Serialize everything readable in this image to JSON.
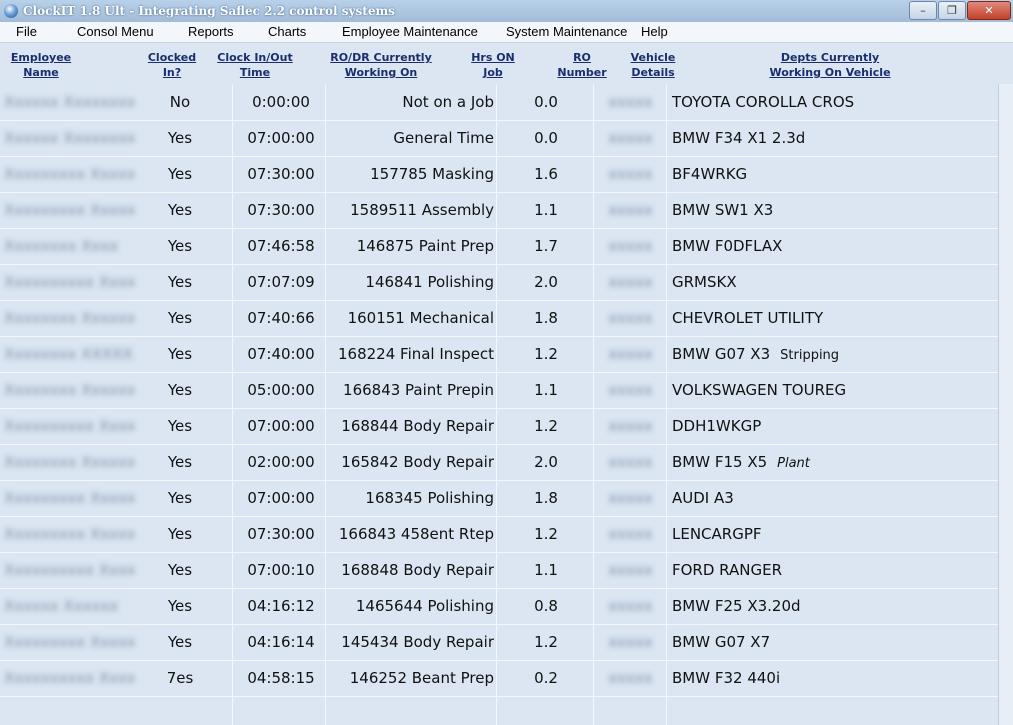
{
  "window": {
    "title": "ClockIT 1.8 Ult - Integrating Saflec 2.2 control systems",
    "minimize_glyph": "–",
    "restore_glyph": "❐",
    "close_glyph": "✕"
  },
  "menu": [
    "File",
    "Consol Menu",
    "Reports",
    "Charts",
    "Employee Maintenance",
    "System Maintenance",
    "Help"
  ],
  "headers": [
    [
      "Employee",
      "Name"
    ],
    [
      "Clocked",
      "In?"
    ],
    [
      "Clock In/Out",
      "Time"
    ],
    [
      "RO/DR Currently",
      "Working On"
    ],
    [
      "Hrs ON",
      "Job"
    ],
    [
      "RO",
      "Number"
    ],
    [
      "Vehicle",
      "Details"
    ],
    [
      "Depts Currently",
      "Working On Vehicle"
    ]
  ],
  "rows": [
    {
      "name": "Xxxxxx Xxxxxxxxxx",
      "clocked": "No",
      "time": "0:00:00",
      "job": "Not on a Job",
      "hrs": "0.0",
      "ro": "xxxxx",
      "vehicle": "TOYOTA COROLLA CROS",
      "note": ""
    },
    {
      "name": "Xxxxxx Xxxxxxxx",
      "clocked": "Yes",
      "time": "07:00:00",
      "job": "General Time",
      "hrs": "0.0",
      "ro": "xxxxx",
      "vehicle": "BMW F34  X1 2.3d",
      "note": ""
    },
    {
      "name": "Xxxxxxxxx Xxxxxxx",
      "clocked": "Yes",
      "time": "07:30:00",
      "job": "157785 Masking",
      "hrs": "1.6",
      "ro": "xxxxx",
      "vehicle": "BF4WRKG",
      "note": ""
    },
    {
      "name": "Xxxxxxxxx Xxxxxxxx",
      "clocked": "Yes",
      "time": "07:30:00",
      "job": "1589511 Assembly",
      "hrs": "1.1",
      "ro": "xxxxx",
      "vehicle": "BMW SW1 X3",
      "note": ""
    },
    {
      "name": "Xxxxxxxx Xxxx",
      "clocked": "Yes",
      "time": "07:46:58",
      "job": "146875 Paint Prep",
      "hrs": "1.7",
      "ro": "xxxxx",
      "vehicle": "BMW F0DFLAX",
      "note": ""
    },
    {
      "name": "Xxxxxxxxxx Xxxxxxx",
      "clocked": "Yes",
      "time": "07:07:09",
      "job": "146841 Polishing",
      "hrs": "2.0",
      "ro": "xxxxx",
      "vehicle": "GRMSKX",
      "note": ""
    },
    {
      "name": "Xxxxxxxx Xxxxxxxx",
      "clocked": "Yes",
      "time": "07:40:66",
      "job": "160151 Mechanical",
      "hrs": "1.8",
      "ro": "xxxxx",
      "vehicle": "CHEVROLET UTILITY",
      "note": ""
    },
    {
      "name": "Xxxxxxxx XXXXXXXX",
      "clocked": "Yes",
      "time": "07:40:00",
      "job": "168224 Final Inspect",
      "hrs": "1.2",
      "ro": "xxxxx",
      "vehicle": "BMW G07 X3",
      "note": "Stripping"
    },
    {
      "name": "Xxxxxxxx Xxxxxxxx",
      "clocked": "Yes",
      "time": "05:00:00",
      "job": "166843 Paint Prepin",
      "hrs": "1.1",
      "ro": "xxxxx",
      "vehicle": "VOLKSWAGEN TOUREG",
      "note": ""
    },
    {
      "name": "Xxxxxxxxxx Xxxxxx",
      "clocked": "Yes",
      "time": "07:00:00",
      "job": "168844 Body Repair",
      "hrs": "1.2",
      "ro": "xxxxx",
      "vehicle": "DDH1WKGP",
      "note": ""
    },
    {
      "name": "Xxxxxxxx Xxxxxxxxxx",
      "clocked": "Yes",
      "time": "02:00:00",
      "job": "165842 Body Repair",
      "hrs": "2.0",
      "ro": "xxxxx",
      "vehicle": "BMW F15 X5",
      "note": "Plant"
    },
    {
      "name": "Xxxxxxxxx Xxxxxx",
      "clocked": "Yes",
      "time": "07:00:00",
      "job": "168345 Polishing",
      "hrs": "1.8",
      "ro": "xxxxx",
      "vehicle": "AUDI A3",
      "note": ""
    },
    {
      "name": "Xxxxxxxxx Xxxxxx",
      "clocked": "Yes",
      "time": "07:30:00",
      "job": "166843 458ent Rtep",
      "hrs": "1.2",
      "ro": "xxxxx",
      "vehicle": "LENCARGPF",
      "note": ""
    },
    {
      "name": "Xxxxxxxxxx Xxxxxx",
      "clocked": "Yes",
      "time": "07:00:10",
      "job": "168848 Body Repair",
      "hrs": "1.1",
      "ro": "xxxxx",
      "vehicle": "FORD RANGER",
      "note": ""
    },
    {
      "name": "Xxxxxx Xxxxxx",
      "clocked": "Yes",
      "time": "04:16:12",
      "job": "1465644 Polishing",
      "hrs": "0.8",
      "ro": "xxxxx",
      "vehicle": "BMW F25 X3.20d",
      "note": ""
    },
    {
      "name": "Xxxxxxxxx Xxxxxxxx",
      "clocked": "Yes",
      "time": "04:16:14",
      "job": "145434 Body Repair",
      "hrs": "1.2",
      "ro": "xxxxx",
      "vehicle": "BMW G07 X7",
      "note": ""
    },
    {
      "name": "Xxxxxxxxxx Xxxxxx",
      "clocked": "7es",
      "time": "04:58:15",
      "job": "146252 Beant Prep",
      "hrs": "0.2",
      "ro": "xxxxx",
      "vehicle": "BMW F32 440i",
      "note": ""
    }
  ]
}
